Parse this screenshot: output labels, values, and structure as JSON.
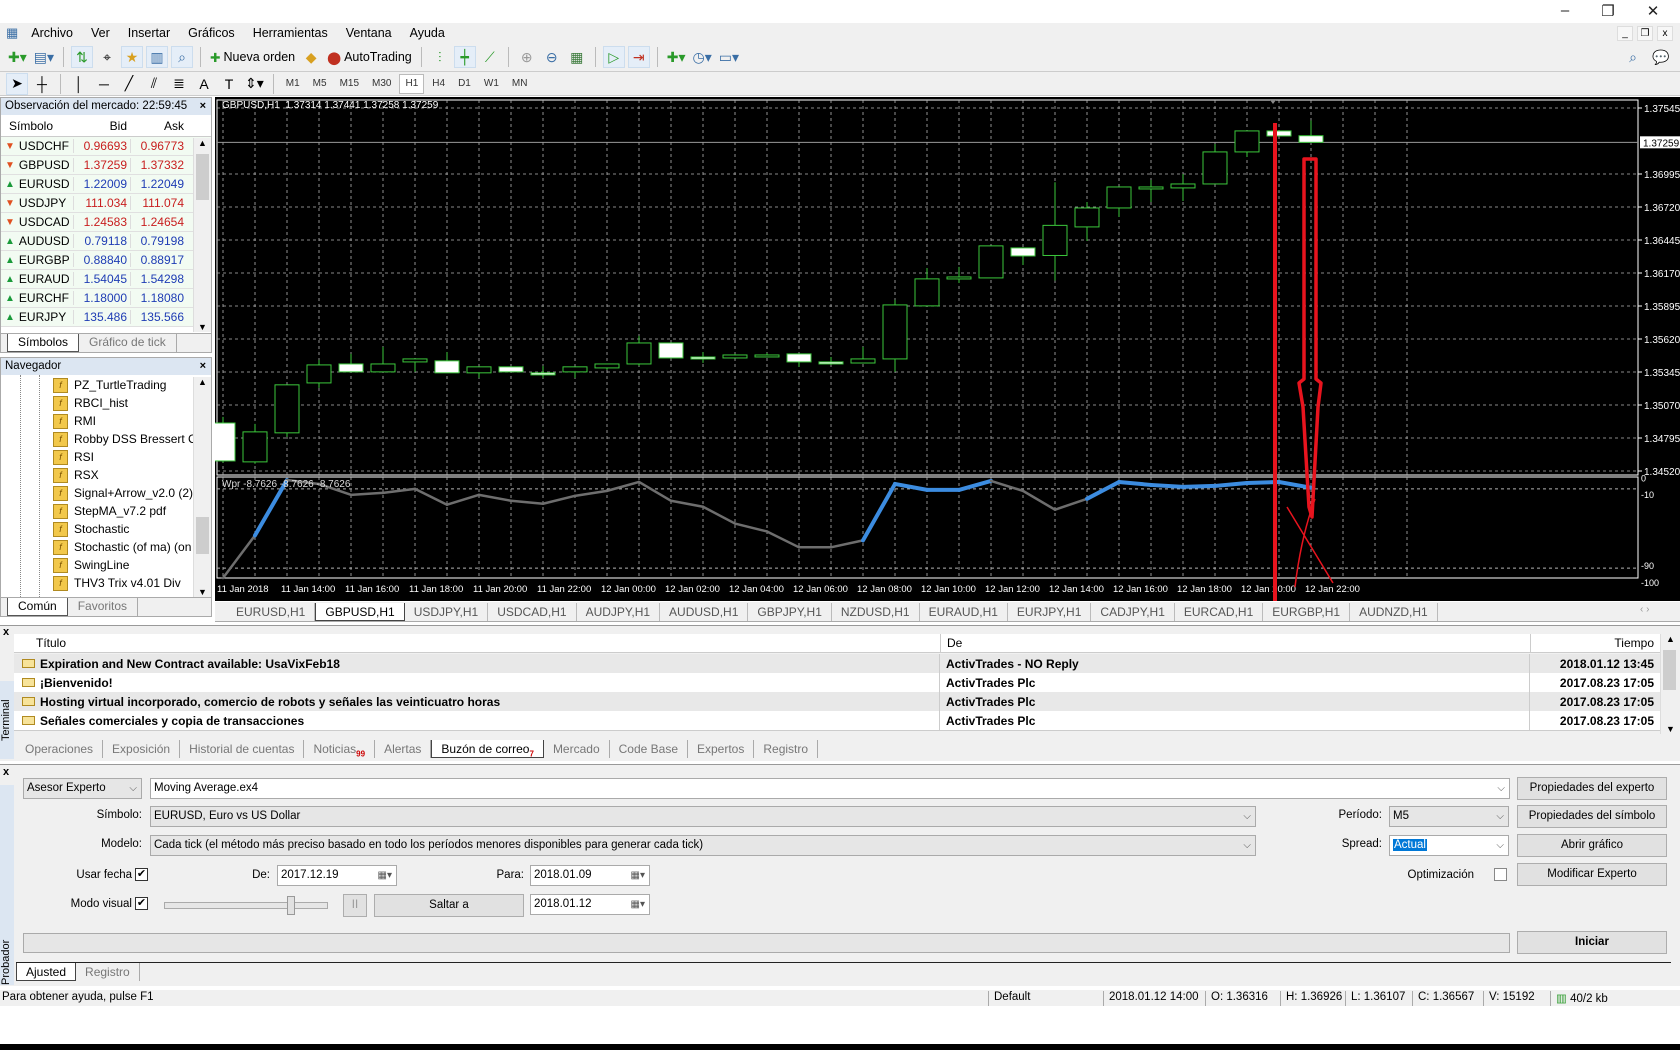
{
  "window": {
    "min": "–",
    "restore": "❐",
    "close": "✕"
  },
  "menu": [
    "Archivo",
    "Ver",
    "Insertar",
    "Gráficos",
    "Herramientas",
    "Ventana",
    "Ayuda"
  ],
  "toolbar": {
    "new_order": "Nueva orden",
    "autotrading": "AutoTrading"
  },
  "timeframes": [
    "M1",
    "M5",
    "M15",
    "M30",
    "H1",
    "H4",
    "D1",
    "W1",
    "MN"
  ],
  "active_timeframe": "H1",
  "market_watch": {
    "title": "Observación del mercado: 22:59:45",
    "headers": [
      "Símbolo",
      "Bid",
      "Ask"
    ],
    "rows": [
      {
        "symbol": "USDCHF",
        "bid": "0.96693",
        "ask": "0.96773",
        "dir": "down"
      },
      {
        "symbol": "GBPUSD",
        "bid": "1.37259",
        "ask": "1.37332",
        "dir": "down"
      },
      {
        "symbol": "EURUSD",
        "bid": "1.22009",
        "ask": "1.22049",
        "dir": "up"
      },
      {
        "symbol": "USDJPY",
        "bid": "111.034",
        "ask": "111.074",
        "dir": "down"
      },
      {
        "symbol": "USDCAD",
        "bid": "1.24583",
        "ask": "1.24654",
        "dir": "down"
      },
      {
        "symbol": "AUDUSD",
        "bid": "0.79118",
        "ask": "0.79198",
        "dir": "up"
      },
      {
        "symbol": "EURGBP",
        "bid": "0.88840",
        "ask": "0.88917",
        "dir": "up"
      },
      {
        "symbol": "EURAUD",
        "bid": "1.54045",
        "ask": "1.54298",
        "dir": "up"
      },
      {
        "symbol": "EURCHF",
        "bid": "1.18000",
        "ask": "1.18080",
        "dir": "up"
      },
      {
        "symbol": "EURJPY",
        "bid": "135.486",
        "ask": "135.566",
        "dir": "up"
      }
    ],
    "tabs": [
      "Símbolos",
      "Gráfico de tick"
    ]
  },
  "navigator": {
    "title": "Navegador",
    "items": [
      "PZ_TurtleTrading",
      "RBCI_hist",
      "RMI",
      "Robby DSS Bressert Co",
      "RSI",
      "RSX",
      "Signal+Arrow_v2.0 (2)",
      "StepMA_v7.2 pdf",
      "Stochastic",
      "Stochastic (of ma) (on",
      "SwingLine",
      "THV3 Trix v4.01 Div"
    ],
    "tabs": [
      "Común",
      "Favoritos"
    ]
  },
  "chart_data": {
    "type": "candlestick",
    "header": "GBPUSD,H1  1.37314 1.37441 1.37258 1.37259",
    "current_price": "1.37259",
    "colors": {
      "background": "#000000",
      "bull": "#3cc83c",
      "bear_fill": "#ffffff",
      "grid": "#b4b4b4",
      "current_line": "#9a9a9a",
      "indicator_highlight": "#3c8ce0",
      "indicator_line": "#6e6e6e",
      "annotation": "#e8141e"
    },
    "price_ticks": [
      "1.37545",
      "1.36995",
      "1.36720",
      "1.36445",
      "1.36170",
      "1.35895",
      "1.35620",
      "1.35345",
      "1.35070",
      "1.34795",
      "1.34520"
    ],
    "ylim": [
      1.3452,
      1.37545
    ],
    "time_labels": [
      "11 Jan 2018",
      "11 Jan 14:00",
      "11 Jan 16:00",
      "11 Jan 18:00",
      "11 Jan 20:00",
      "11 Jan 22:00",
      "12 Jan 00:00",
      "12 Jan 02:00",
      "12 Jan 04:00",
      "12 Jan 06:00",
      "12 Jan 08:00",
      "12 Jan 10:00",
      "12 Jan 12:00",
      "12 Jan 14:00",
      "12 Jan 16:00",
      "12 Jan 18:00",
      "12 Jan 20:00",
      "12 Jan 22:00"
    ],
    "ohlc": [
      [
        1.3492,
        1.34971,
        1.3459,
        1.34604
      ],
      [
        1.34596,
        1.34913,
        1.3458,
        1.34846
      ],
      [
        1.34838,
        1.35238,
        1.34804,
        1.35238
      ],
      [
        1.35254,
        1.35446,
        1.35213,
        1.35404
      ],
      [
        1.35412,
        1.35496,
        1.35346,
        1.35346
      ],
      [
        1.35346,
        1.35554,
        1.35346,
        1.35412
      ],
      [
        1.35429,
        1.35454,
        1.35346,
        1.35454
      ],
      [
        1.35438,
        1.35512,
        1.35338,
        1.35338
      ],
      [
        1.35338,
        1.35388,
        1.35296,
        1.35388
      ],
      [
        1.35388,
        1.35388,
        1.35346,
        1.35346
      ],
      [
        1.35338,
        1.35396,
        1.35296,
        1.35321
      ],
      [
        1.35346,
        1.35388,
        1.35296,
        1.35388
      ],
      [
        1.35379,
        1.35412,
        1.35363,
        1.35412
      ],
      [
        1.35412,
        1.35646,
        1.35396,
        1.35587
      ],
      [
        1.35587,
        1.35587,
        1.35462,
        1.35462
      ],
      [
        1.3547,
        1.35512,
        1.35421,
        1.35462
      ],
      [
        1.35462,
        1.35496,
        1.35462,
        1.35487
      ],
      [
        1.35487,
        1.35504,
        1.35471,
        1.35487
      ],
      [
        1.35496,
        1.35496,
        1.35388,
        1.35429
      ],
      [
        1.35429,
        1.3547,
        1.35404,
        1.3542
      ],
      [
        1.3542,
        1.35554,
        1.3542,
        1.35454
      ],
      [
        1.35454,
        1.35946,
        1.35346,
        1.35904
      ],
      [
        1.35896,
        1.36212,
        1.35896,
        1.36121
      ],
      [
        1.36129,
        1.36221,
        1.36087,
        1.36137
      ],
      [
        1.36129,
        1.36396,
        1.36129,
        1.36396
      ],
      [
        1.36379,
        1.36379,
        1.36237,
        1.36312
      ],
      [
        1.36316,
        1.36926,
        1.36107,
        1.36567
      ],
      [
        1.36554,
        1.36762,
        1.36437,
        1.36712
      ],
      [
        1.36712,
        1.36887,
        1.36637,
        1.36887
      ],
      [
        1.36879,
        1.36945,
        1.36762,
        1.36887
      ],
      [
        1.36879,
        1.36995,
        1.3677,
        1.36912
      ],
      [
        1.36912,
        1.37245,
        1.36912,
        1.37179
      ],
      [
        1.37179,
        1.37354,
        1.37137,
        1.37354
      ],
      [
        1.37354,
        1.37354,
        1.37312,
        1.37312
      ],
      [
        1.37314,
        1.37441,
        1.37258,
        1.37259
      ]
    ],
    "indicator": {
      "label": "Wpr -8.7626 -8.7626 -8.7626",
      "ylim": [
        -100,
        0
      ],
      "levels": [
        -10,
        -90
      ],
      "level_labels": [
        "0",
        "-10",
        "-90",
        "-100"
      ],
      "values": [
        -100,
        -57,
        -1,
        -5,
        -16,
        -14,
        -10,
        -26,
        -16,
        -22,
        -25,
        -17,
        -12,
        -3,
        -22,
        -28,
        -45,
        -53,
        -69,
        -69,
        -62,
        -5,
        -11,
        -11,
        -2,
        -12,
        -31,
        -20,
        -3,
        -6,
        -8,
        -7,
        -4,
        -3,
        -8.76
      ],
      "highlight": [
        false,
        true,
        true,
        false,
        false,
        false,
        false,
        false,
        false,
        false,
        false,
        false,
        true,
        false,
        false,
        false,
        false,
        false,
        false,
        false,
        true,
        true,
        true,
        true,
        true,
        false,
        false,
        true,
        true,
        true,
        true,
        true,
        true,
        true,
        true
      ]
    },
    "annotations": "red vertical line, red down arrow, red cross"
  },
  "chart_tabs": [
    "EURUSD,H1",
    "GBPUSD,H1",
    "USDJPY,H1",
    "USDCAD,H1",
    "AUDJPY,H1",
    "AUDUSD,H1",
    "GBPJPY,H1",
    "NZDUSD,H1",
    "EURAUD,H1",
    "EURJPY,H1",
    "CADJPY,H1",
    "EURCAD,H1",
    "EURGBP,H1",
    "AUDNZD,H1"
  ],
  "active_chart_tab": "GBPUSD,H1",
  "terminal": {
    "label": "Terminal",
    "headers": [
      "Título",
      "De",
      "Tiempo"
    ],
    "rows": [
      {
        "title": "Expiration and New Contract available: UsaVixFeb18",
        "from": "ActivTrades - NO Reply",
        "time": "2018.01.12 13:45"
      },
      {
        "title": "¡Bienvenido!",
        "from": "ActivTrades Plc",
        "time": "2017.08.23 17:05"
      },
      {
        "title": "Hosting virtual incorporado, comercio de robots y señales las veinticuatro horas",
        "from": "ActivTrades Plc",
        "time": "2017.08.23 17:05"
      },
      {
        "title": "Señales comerciales y copia de transacciones",
        "from": "ActivTrades Plc",
        "time": "2017.08.23 17:05"
      }
    ],
    "tabs": [
      {
        "label": "Operaciones"
      },
      {
        "label": "Exposición"
      },
      {
        "label": "Historial de cuentas"
      },
      {
        "label": "Noticias",
        "badge": "99"
      },
      {
        "label": "Alertas"
      },
      {
        "label": "Buzón de correo",
        "badge": "7",
        "active": true
      },
      {
        "label": "Mercado"
      },
      {
        "label": "Code Base"
      },
      {
        "label": "Expertos"
      },
      {
        "label": "Registro"
      }
    ]
  },
  "tester": {
    "label": "Probador",
    "type": "Asesor Experto",
    "expert": "Moving Average.ex4",
    "symbol_label": "Símbolo:",
    "symbol": "EURUSD, Euro vs US Dollar",
    "model_label": "Modelo:",
    "model": "Cada tick (el método más preciso basado en todo los períodos menores disponibles para generar cada tick)",
    "period_label": "Período:",
    "period": "M5",
    "spread_label": "Spread:",
    "spread": "Actual",
    "use_date_label": "Usar fecha",
    "use_date": true,
    "from_label": "De:",
    "from": "2017.12.19",
    "to_label": "Para:",
    "to": "2018.01.09",
    "visual_label": "Modo visual",
    "visual": true,
    "visual_speed": 0.78,
    "pause": "II",
    "skip_to": "Saltar a",
    "skip_date": "2018.01.12",
    "optimization_label": "Optimización",
    "optimization": false,
    "buttons": {
      "expert_props": "Propiedades del experto",
      "symbol_props": "Propiedades del símbolo",
      "open_chart": "Abrir gráfico",
      "modify": "Modificar Experto",
      "start": "Iniciar"
    },
    "tabs": [
      "Ajusted",
      "Registro"
    ]
  },
  "status": {
    "help": "Para obtener ayuda, pulse F1",
    "profile": "Default",
    "time": "2018.01.12 14:00",
    "open": "O: 1.36316",
    "high": "H: 1.36926",
    "low": "L: 1.36107",
    "close": "C: 1.36567",
    "volume": "V: 15192",
    "traffic": "40/2 kb"
  }
}
